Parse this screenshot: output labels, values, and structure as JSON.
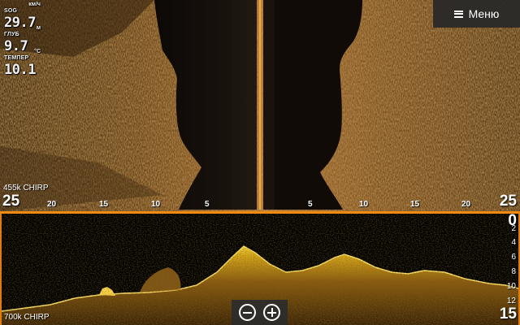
{
  "menu": {
    "label": "Меню",
    "icon": "hamburger-icon"
  },
  "readouts": [
    {
      "label": "SOG",
      "unit": "км/ч",
      "value": "29.7"
    },
    {
      "label": "ГЛУБ",
      "unit": "м",
      "value": "9.7"
    },
    {
      "label": "ТЕМПЕР",
      "unit": "°C",
      "value": "10.1"
    }
  ],
  "side_scan": {
    "frequency": "455k CHIRP",
    "range_left_max": "25",
    "range_right_max": "25",
    "range_ticks_left": [
      "20",
      "15",
      "10",
      "5"
    ],
    "range_ticks_right": [
      "5",
      "10",
      "15",
      "20"
    ]
  },
  "down_scan": {
    "frequency": "700k CHIRP",
    "depth_top": "0",
    "depth_ticks": [
      "2",
      "4",
      "6",
      "8",
      "10",
      "12"
    ],
    "depth_bottom": "15"
  },
  "zoom": {
    "out_icon": "zoom-out-icon",
    "in_icon": "zoom-in-icon"
  },
  "colors": {
    "accent": "#f08a10",
    "sonar_bottom": "#d8b21c",
    "side_scan_tone": "#8a5a22"
  }
}
